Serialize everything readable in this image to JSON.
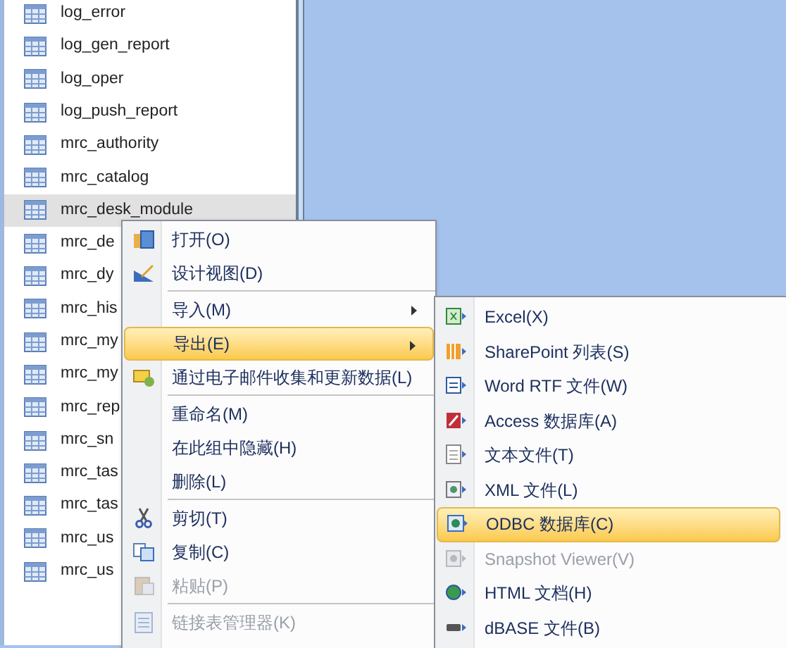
{
  "tables": [
    {
      "name": "log_error",
      "selected": false
    },
    {
      "name": "log_gen_report",
      "selected": false
    },
    {
      "name": "log_oper",
      "selected": false
    },
    {
      "name": "log_push_report",
      "selected": false
    },
    {
      "name": "mrc_authority",
      "selected": false
    },
    {
      "name": "mrc_catalog",
      "selected": false
    },
    {
      "name": "mrc_desk_module",
      "selected": true
    },
    {
      "name": "mrc_de",
      "selected": false
    },
    {
      "name": "mrc_dy",
      "selected": false
    },
    {
      "name": "mrc_his",
      "selected": false
    },
    {
      "name": "mrc_my",
      "selected": false
    },
    {
      "name": "mrc_my",
      "selected": false
    },
    {
      "name": "mrc_rep",
      "selected": false
    },
    {
      "name": "mrc_sn",
      "selected": false
    },
    {
      "name": "mrc_tas",
      "selected": false
    },
    {
      "name": "mrc_tas",
      "selected": false
    },
    {
      "name": "mrc_us",
      "selected": false
    },
    {
      "name": "mrc_us",
      "selected": false
    }
  ],
  "context_menu": [
    {
      "kind": "item",
      "label": "打开(O)",
      "disabled": false,
      "selected": false,
      "submenu": false
    },
    {
      "kind": "item",
      "label": "设计视图(D)",
      "disabled": false,
      "selected": false,
      "submenu": false
    },
    {
      "kind": "separator"
    },
    {
      "kind": "item",
      "label": "导入(M)",
      "disabled": false,
      "selected": false,
      "submenu": true
    },
    {
      "kind": "item",
      "label": "导出(E)",
      "disabled": false,
      "selected": true,
      "submenu": true
    },
    {
      "kind": "item",
      "label": "通过电子邮件收集和更新数据(L)",
      "disabled": false,
      "selected": false,
      "submenu": false
    },
    {
      "kind": "separator"
    },
    {
      "kind": "item",
      "label": "重命名(M)",
      "disabled": false,
      "selected": false,
      "submenu": false
    },
    {
      "kind": "item",
      "label": "在此组中隐藏(H)",
      "disabled": false,
      "selected": false,
      "submenu": false
    },
    {
      "kind": "item",
      "label": "删除(L)",
      "disabled": false,
      "selected": false,
      "submenu": false
    },
    {
      "kind": "separator"
    },
    {
      "kind": "item",
      "label": "剪切(T)",
      "disabled": false,
      "selected": false,
      "submenu": false
    },
    {
      "kind": "item",
      "label": "复制(C)",
      "disabled": false,
      "selected": false,
      "submenu": false
    },
    {
      "kind": "item",
      "label": "粘贴(P)",
      "disabled": true,
      "selected": false,
      "submenu": false
    },
    {
      "kind": "separator"
    },
    {
      "kind": "item",
      "label": "链接表管理器(K)",
      "disabled": true,
      "selected": false,
      "submenu": false
    }
  ],
  "export_menu": [
    {
      "label": "Excel(X)",
      "disabled": false,
      "selected": false
    },
    {
      "label": "SharePoint 列表(S)",
      "disabled": false,
      "selected": false
    },
    {
      "label": "Word RTF 文件(W)",
      "disabled": false,
      "selected": false
    },
    {
      "label": "Access 数据库(A)",
      "disabled": false,
      "selected": false
    },
    {
      "label": "文本文件(T)",
      "disabled": false,
      "selected": false
    },
    {
      "label": "XML 文件(L)",
      "disabled": false,
      "selected": false
    },
    {
      "label": "ODBC 数据库(C)",
      "disabled": false,
      "selected": true
    },
    {
      "label": "Snapshot Viewer(V)",
      "disabled": true,
      "selected": false
    },
    {
      "label": "HTML 文档(H)",
      "disabled": false,
      "selected": false
    },
    {
      "label": "dBASE 文件(B)",
      "disabled": false,
      "selected": false
    }
  ]
}
